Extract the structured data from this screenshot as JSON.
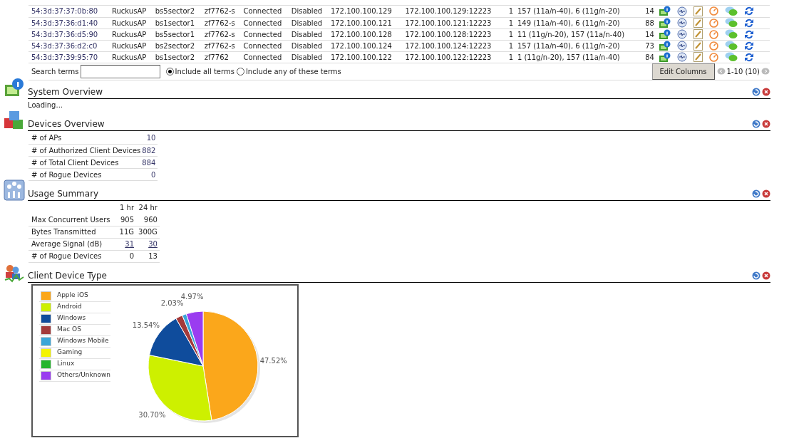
{
  "ap_table": {
    "rows": [
      {
        "cells": [
          "54:3d:37:37:0b:80",
          "RuckusAP",
          "bs5sector2",
          "zf7762-s",
          "Connected",
          "Disabled",
          "172.100.100.129",
          "172.100.100.129:12223",
          "1",
          "157 (11a/n-40), 6 (11g/n-20)",
          "14"
        ]
      },
      {
        "cells": [
          "54:3d:37:36:d1:40",
          "RuckusAP",
          "bs1sector1",
          "zf7762-s",
          "Connected",
          "Disabled",
          "172.100.100.121",
          "172.100.100.121:12223",
          "1",
          "149 (11a/n-40), 6 (11g/n-20)",
          "88"
        ]
      },
      {
        "cells": [
          "54:3d:37:36:d5:90",
          "RuckusAP",
          "bs5sector1",
          "zf7762-s",
          "Connected",
          "Disabled",
          "172.100.100.128",
          "172.100.100.128:12223",
          "1",
          "11 (11g/n-20), 157 (11a/n-40)",
          "14"
        ]
      },
      {
        "cells": [
          "54:3d:37:36:d2:c0",
          "RuckusAP",
          "bs2sector2",
          "zf7762-s",
          "Connected",
          "Disabled",
          "172.100.100.124",
          "172.100.100.124:12223",
          "1",
          "157 (11a/n-40), 6 (11g/n-20)",
          "73"
        ]
      },
      {
        "cells": [
          "54:3d:37:39:95:70",
          "RuckusAP",
          "bs1sector2",
          "zf7762",
          "Connected",
          "Disabled",
          "172.100.100.122",
          "172.100.100.122:12223",
          "1",
          "1 (11g/n-20), 157 (11a/n-40)",
          "84"
        ]
      }
    ],
    "search_label": "Search terms",
    "match_options": [
      {
        "label": "Include all terms",
        "selected": true
      },
      {
        "label": "Include any of these terms",
        "selected": false
      }
    ],
    "edit_columns_button": "Edit Columns",
    "pagination": "1-10 (10)"
  },
  "widgets": [
    {
      "kind": "text",
      "title": "System Overview",
      "text": "Loading..."
    },
    {
      "kind": "stats",
      "title": "Devices Overview",
      "rows": [
        {
          "label": "# of APs",
          "value": "10"
        },
        {
          "label": "# of Authorized Client Devices",
          "value": "882"
        },
        {
          "label": "# of Total Client Devices",
          "value": "884"
        },
        {
          "label": "# of Rogue Devices",
          "value": "0"
        }
      ]
    },
    {
      "kind": "usage",
      "title": "Usage Summary",
      "columns": [
        "1 hr",
        "24 hr"
      ],
      "rows": [
        {
          "label": "Max Concurrent Users",
          "values": [
            "905",
            "960"
          ],
          "linked": false
        },
        {
          "label": "Bytes Transmitted",
          "values": [
            "11G",
            "300G"
          ],
          "linked": false
        },
        {
          "label": "Average Signal (dB)",
          "values": [
            "31",
            "30"
          ],
          "linked": true
        },
        {
          "label": "# of Rogue Devices",
          "values": [
            "0",
            "13"
          ],
          "linked": false
        }
      ]
    },
    {
      "kind": "chart",
      "title": "Client Device Type",
      "chart_data": {
        "type": "pie",
        "categories": [
          "Apple iOS",
          "Android",
          "Windows",
          "Mac OS",
          "Windows Mobile",
          "Gaming",
          "Linux",
          "Others/Unknown"
        ],
        "values": [
          47.52,
          30.7,
          13.54,
          2.03,
          1.24,
          0,
          0,
          4.97
        ],
        "colors": [
          "#fba71b",
          "#cdf000",
          "#0f4c9c",
          "#a33a3a",
          "#3aa6d8",
          "#f4f400",
          "#25b52c",
          "#9a3cf0"
        ],
        "value_labels": [
          "47.52%",
          "30.70%",
          "13.54%",
          "2.03%",
          null,
          null,
          null,
          "4.97%"
        ]
      }
    }
  ]
}
